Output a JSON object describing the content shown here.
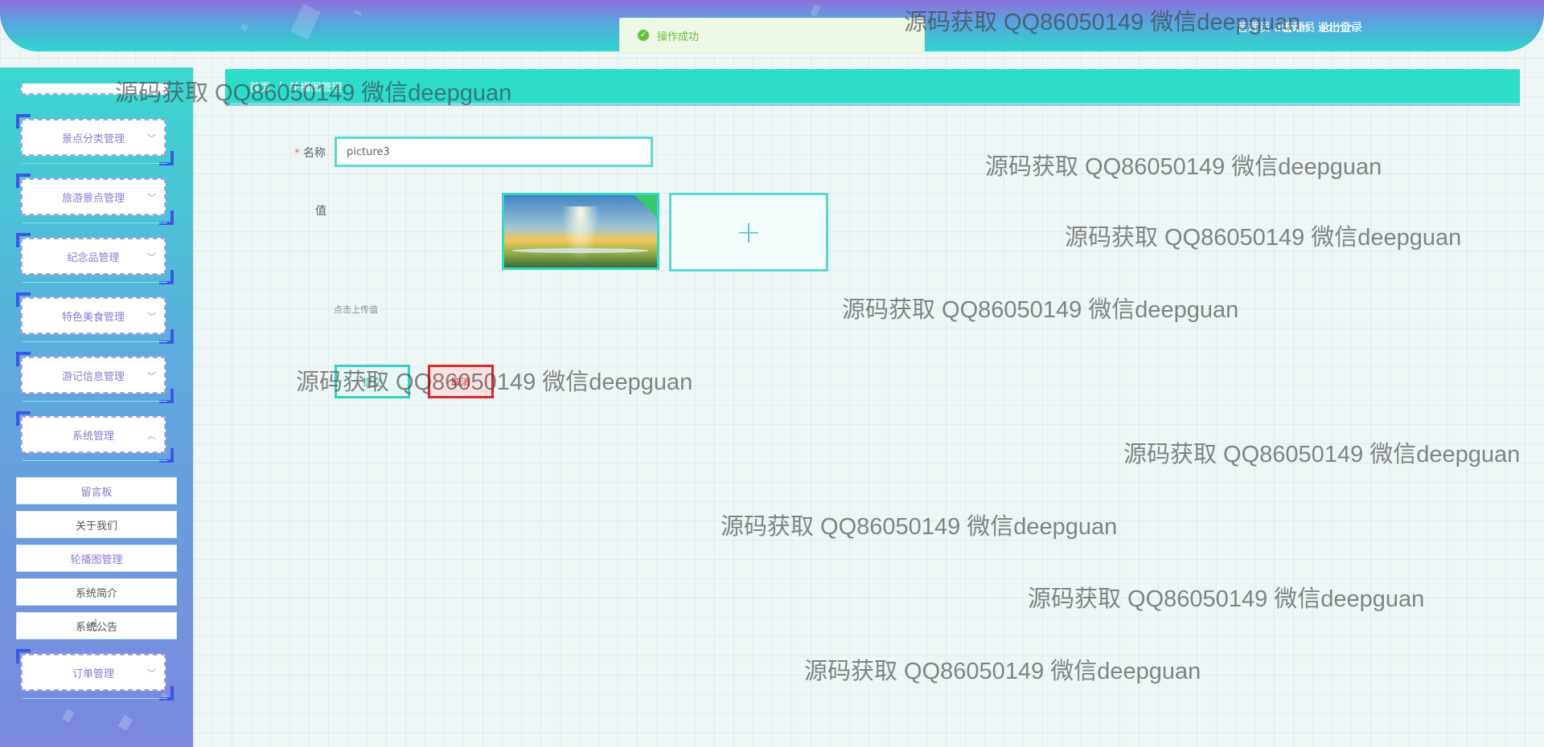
{
  "header": {
    "user_label": "管理员 admin",
    "logout_label": "退出登录"
  },
  "toast": {
    "icon": "check-circle-icon",
    "message": "操作成功"
  },
  "breadcrumb": {
    "items": [
      "首页",
      "轮播图管理"
    ]
  },
  "sidebar": {
    "menus": [
      {
        "label": "景点分类管理",
        "icon": "chevron-down-icon"
      },
      {
        "label": "旅游景点管理",
        "icon": "chevron-down-icon"
      },
      {
        "label": "纪念品管理",
        "icon": "chevron-down-icon"
      },
      {
        "label": "特色美食管理",
        "icon": "chevron-down-icon"
      },
      {
        "label": "游记信息管理",
        "icon": "chevron-down-icon"
      },
      {
        "label": "系统管理",
        "icon": "chevron-up-icon"
      },
      {
        "label": "订单管理",
        "icon": "chevron-down-icon"
      }
    ],
    "submenu": [
      "留言板",
      "关于我们",
      "轮播图管理",
      "系统简介",
      "系统公告"
    ]
  },
  "form": {
    "name_label": "名称",
    "name_value": "picture3",
    "value_label": "值",
    "upload_tip": "点击上传值",
    "submit_label": "提交",
    "cancel_label": "取消"
  },
  "watermark": "源码获取 QQ86050149 微信deepguan"
}
